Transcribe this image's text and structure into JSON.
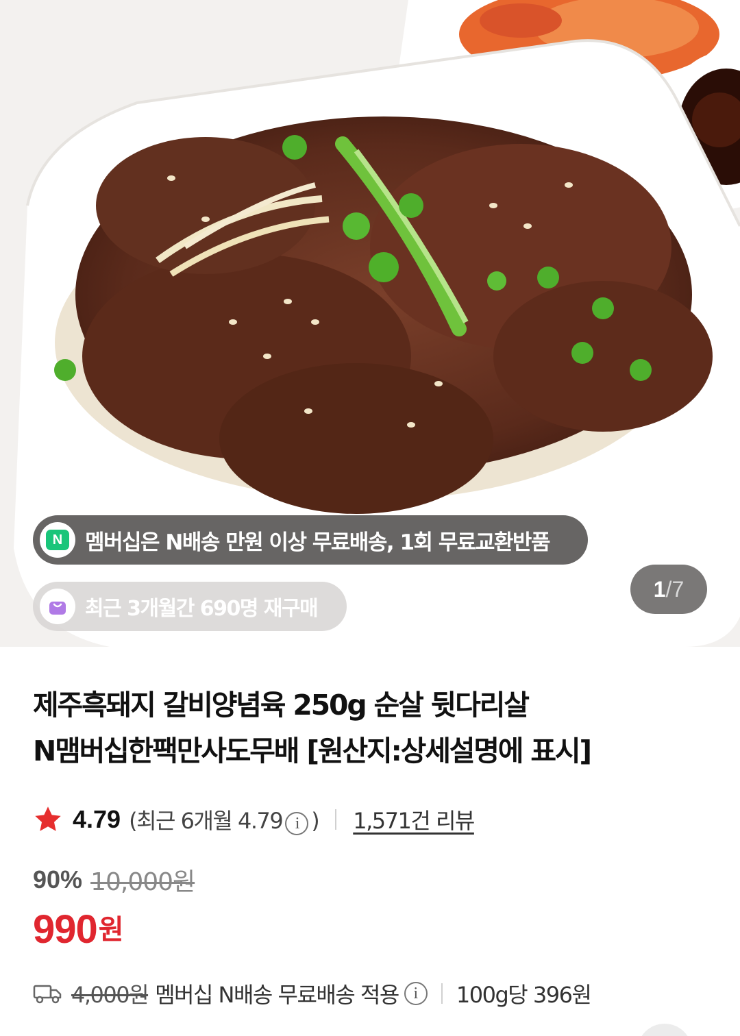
{
  "photo": {
    "alt_label": "product-photo",
    "membership_badge": {
      "icon": "n-delivery-icon",
      "icon_text": "N",
      "text": "멤버십은 N배송 만원 이상 무료배송, 1회 무료교환반품"
    },
    "repurchase_badge": {
      "icon": "shopping-bag-icon",
      "text": "최근 3개월간 690명 재구매"
    },
    "pager": {
      "current": "1",
      "separator": "/",
      "total": "7"
    }
  },
  "product": {
    "title_line1": "제주흑돼지 갈비양념육 250g 순살 뒷다리살",
    "title_line2": "N맴버십한팩만사도무배 [원산지:상세설명에 표시]"
  },
  "rating": {
    "icon": "star-icon",
    "score": "4.79",
    "recent_prefix": "(최근 6개월 4.79",
    "recent_suffix": ")",
    "info_glyph": "i",
    "reviews": "1,571건 리뷰",
    "star_color": "#e62e2e"
  },
  "price": {
    "discount": "90%",
    "original": "10,000원",
    "sale": "990",
    "currency": "원",
    "sale_color": "#e0262f"
  },
  "shipping": {
    "icon": "truck-icon",
    "original_fee": "4,000원",
    "note": "멤버십 N배송 무료배송 적용",
    "info_glyph": "i",
    "unit_price": "100g당 396원"
  }
}
